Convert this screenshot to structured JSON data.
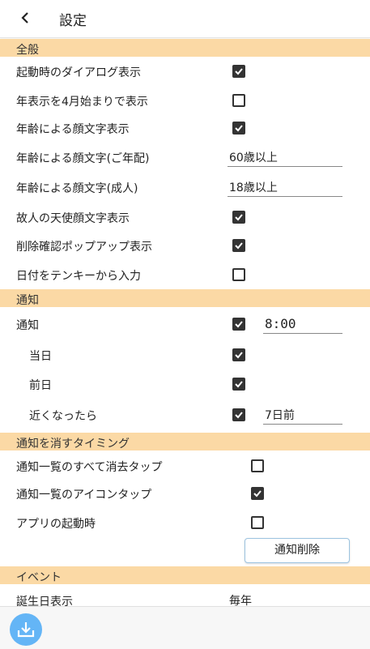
{
  "header": {
    "title": "設定"
  },
  "general": {
    "section": "全般",
    "startup_dialog": "起動時のダイアログ表示",
    "year_april": "年表示を4月始まりで表示",
    "age_emoticon": "年齢による顔文字表示",
    "age_emoticon_elderly": "年齢による顔文字(ご年配)",
    "elderly_value": "60歳以上",
    "age_emoticon_adult": "年齢による顔文字(成人)",
    "adult_value": "18歳以上",
    "deceased_angel": "故人の天使顔文字表示",
    "delete_confirm": "削除確認ポップアップ表示",
    "date_tenkey": "日付をテンキーから入力"
  },
  "notification": {
    "section": "通知",
    "notify": "通知",
    "notify_time": "8:00",
    "same_day": "当日",
    "day_before": "前日",
    "approaching": "近くなったら",
    "approaching_value": "7日前"
  },
  "dismiss": {
    "section": "通知を消すタイミング",
    "list_clear_all": "通知一覧のすべて消去タップ",
    "list_icon_tap": "通知一覧のアイコンタップ",
    "app_start": "アプリの起動時",
    "delete_button": "通知削除"
  },
  "event": {
    "section": "イベント",
    "birthday_display": "誕生日表示",
    "birthday_value": "毎年"
  },
  "checkboxes": {
    "startup_dialog": true,
    "year_april": false,
    "age_emoticon": true,
    "deceased_angel": true,
    "delete_confirm": true,
    "date_tenkey": false,
    "notify": true,
    "same_day": true,
    "day_before": true,
    "approaching": true,
    "list_clear_all": false,
    "list_icon_tap": true,
    "app_start": false
  },
  "colors": {
    "section_bg": "#fbd9a5",
    "fab": "#64b5f6",
    "button_border": "#9cc3e0"
  },
  "icons": {
    "back": "chevron-left-icon",
    "fab": "download-icon"
  }
}
